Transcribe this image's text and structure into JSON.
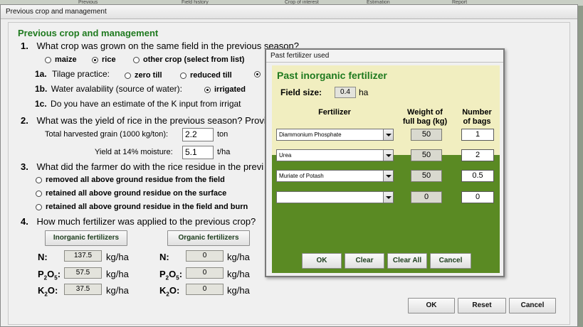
{
  "background": {
    "tabs": [
      "Previous",
      "Field history",
      "Crop of interest",
      "Estimation",
      "Report"
    ]
  },
  "window": {
    "title": "Previous crop and management",
    "heading": "Previous crop and management"
  },
  "q1": {
    "number": "1.",
    "text": "What crop was grown on the same field in the previous season?",
    "options": [
      "maize",
      "rice",
      "other crop (select from list)"
    ],
    "selected": "rice",
    "q1a_label": "1a.",
    "q1a_text": "Tilage practice:",
    "q1a_options": [
      "zero till",
      "reduced till"
    ],
    "q1b_label": "1b.",
    "q1b_text": "Water avalability (source of water):",
    "q1b_option": "irrigated",
    "q1c_label": "1c.",
    "q1c_text": "Do you have an estimate  of the K input from irrigat"
  },
  "q2": {
    "number": "2.",
    "text": "What was the yield of rice in the previous season? Provi",
    "grain_label": "Total harvested grain (1000 kg/ton):",
    "grain_value": "2.2",
    "grain_unit": "ton",
    "yield_label": "Yield at 14% moisture:",
    "yield_value": "5.1",
    "yield_unit": "t/ha"
  },
  "q3": {
    "number": "3.",
    "text": "What did the farmer do with the rice residue in the previ",
    "options": [
      "removed all above ground residue from the field",
      "retained all above ground residue on the surface",
      "retained all above ground residue in the field and burn"
    ]
  },
  "q4": {
    "number": "4.",
    "text": "How much fertilizer was applied to the previous crop?",
    "inorganic_button": "Inorganic fertilizers",
    "organic_button": "Organic fertilizers",
    "unit": "kg/ha",
    "inorganic": {
      "N": "137.5",
      "P": "57.5",
      "K": "37.5"
    },
    "organic": {
      "N": "0",
      "P": "0",
      "K": "0"
    },
    "labels": {
      "N": "N:",
      "P": "P",
      "P_sub1": "2",
      "P_mid": "O",
      "P_sub2": "5",
      "K": "K",
      "K_sub": "2",
      "K_mid": "O:"
    }
  },
  "footer": {
    "ok": "OK",
    "reset": "Reset",
    "cancel": "Cancel"
  },
  "dialog": {
    "title": "Past fertilizer used",
    "heading": "Past inorganic fertilizer",
    "field_size_label": "Field size:",
    "field_size_value": "0.4",
    "field_size_unit": "ha",
    "col_fertilizer": "Fertilizer",
    "col_weight_1": "Weight of",
    "col_weight_2": "full bag (kg)",
    "col_bags_1": "Number",
    "col_bags_2": "of bags",
    "rows": [
      {
        "fertilizer": "Diammonium Phosphate",
        "weight": "50",
        "bags": "1"
      },
      {
        "fertilizer": "Urea",
        "weight": "50",
        "bags": "2"
      },
      {
        "fertilizer": "Muriate of Potash",
        "weight": "50",
        "bags": "0.5"
      },
      {
        "fertilizer": "",
        "weight": "0",
        "bags": "0"
      }
    ],
    "ok": "OK",
    "clear": "Clear",
    "clear_all": "Clear All",
    "cancel": "Cancel"
  }
}
